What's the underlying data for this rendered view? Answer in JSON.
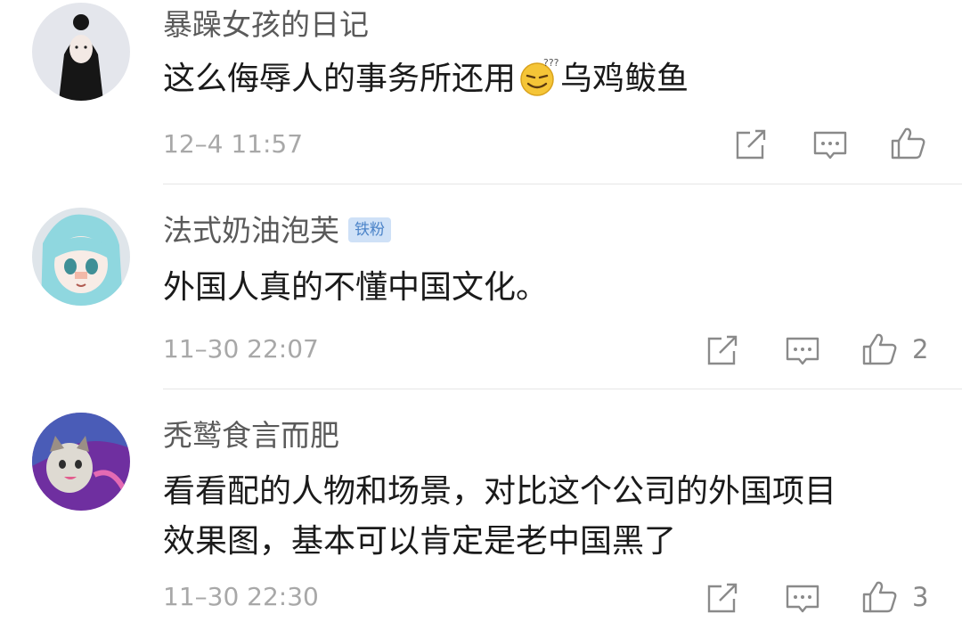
{
  "comments": [
    {
      "username": "暴躁女孩的日记",
      "badge": "",
      "content_before_emoji": "这么侮辱人的事务所还用",
      "content_after_emoji": "乌鸡鲅鱼",
      "content_line2": "",
      "time": "12–4 11:57",
      "likes": ""
    },
    {
      "username": "法式奶油泡芙",
      "badge": "铁粉",
      "content_before_emoji": "外国人真的不懂中国文化。",
      "content_after_emoji": "",
      "content_line2": "",
      "time": "11–30 22:07",
      "likes": "2"
    },
    {
      "username": "秃鹫食言而肥",
      "badge": "",
      "content_before_emoji": "看看配的人物和场景，对比这个公司的外国项目",
      "content_after_emoji": "",
      "content_line2": "效果图，基本可以肯定是老中国黑了",
      "time": "11–30 22:30",
      "likes": "3"
    }
  ],
  "icons": {
    "share": "share-icon",
    "reply": "comment-icon",
    "like": "thumbs-up-icon",
    "emoji": "sweat-smile-emoji"
  },
  "colors": {
    "username": "#5a5a5a",
    "content": "#1a1a1a",
    "time": "#a8a8a8",
    "badge_bg": "#cfe1f7",
    "badge_text": "#4b83c8",
    "icon": "#8a8a8a"
  }
}
